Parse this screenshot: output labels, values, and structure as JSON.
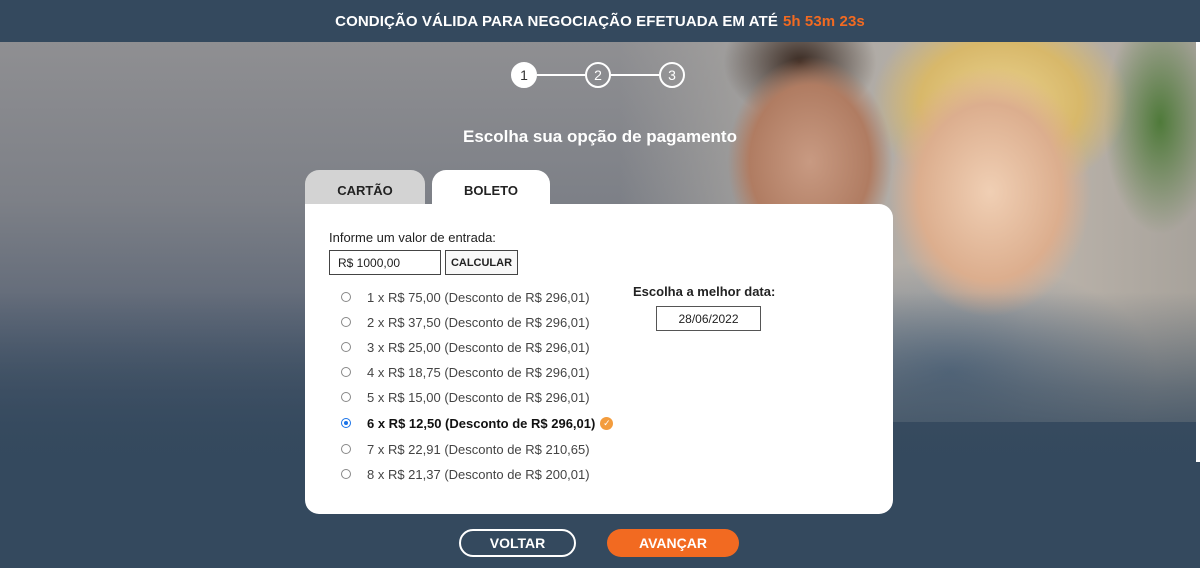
{
  "banner": {
    "text": "CONDIÇÃO VÁLIDA PARA NEGOCIAÇÃO EFETUADA EM ATÉ",
    "timer": "5h 53m 23s"
  },
  "stepper": {
    "steps": [
      "1",
      "2",
      "3"
    ],
    "active_step": "1"
  },
  "heading": "Escolha sua opção de pagamento",
  "tabs": {
    "card": "CARTÃO",
    "boleto": "BOLETO",
    "active": "boleto"
  },
  "entry": {
    "label": "Informe um valor de entrada:",
    "value": "R$ 1000,00",
    "calc_button": "CALCULAR"
  },
  "options": [
    {
      "text": "1 x R$ 75,00 (Desconto de R$ 296,01)",
      "selected": false
    },
    {
      "text": "2 x R$ 37,50 (Desconto de R$ 296,01)",
      "selected": false
    },
    {
      "text": "3 x R$ 25,00 (Desconto de R$ 296,01)",
      "selected": false
    },
    {
      "text": "4 x R$ 18,75 (Desconto de R$ 296,01)",
      "selected": false
    },
    {
      "text": "5 x R$ 15,00 (Desconto de R$ 296,01)",
      "selected": false
    },
    {
      "text": "6 x R$ 12,50 (Desconto de R$ 296,01)",
      "selected": true
    },
    {
      "text": "7 x R$ 22,91 (Desconto de R$ 210,65)",
      "selected": false
    },
    {
      "text": "8 x R$ 21,37 (Desconto de R$ 200,01)",
      "selected": false
    }
  ],
  "date": {
    "label": "Escolha a melhor data:",
    "value": "28/06/2022"
  },
  "actions": {
    "back": "VOLTAR",
    "next": "AVANÇAR"
  },
  "colors": {
    "accent": "#f26a21",
    "background": "#34495e",
    "check_badge": "#f39c3d"
  },
  "icons": {
    "selected_check": "check-circle-icon"
  }
}
